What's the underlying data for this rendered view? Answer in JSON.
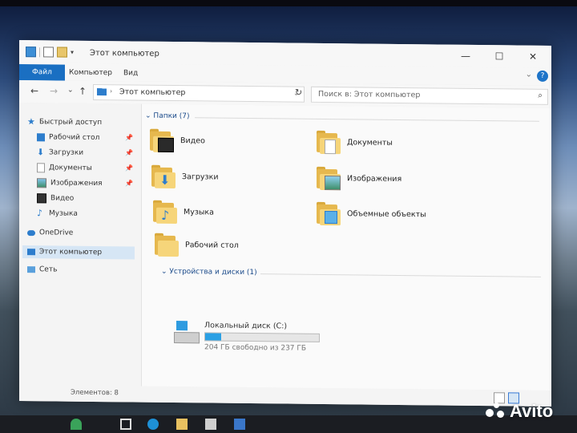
{
  "window": {
    "title": "Этот компьютер",
    "controls": {
      "minimize": "—",
      "maximize": "☐",
      "close": "✕"
    }
  },
  "ribbon": {
    "tabs": [
      "Файл",
      "Компьютер",
      "Вид"
    ],
    "help": "?"
  },
  "navigation": {
    "back": "←",
    "forward": "→",
    "recent": "⌄",
    "up": "↑",
    "address": "Этот компьютер",
    "refresh": "↻",
    "search_placeholder": "Поиск в: Этот компьютер"
  },
  "sidebar": {
    "items": [
      {
        "label": "Быстрый доступ",
        "icon": "star-icon",
        "pinned": false
      },
      {
        "label": "Рабочий стол",
        "icon": "desktop-icon",
        "pinned": true
      },
      {
        "label": "Загрузки",
        "icon": "download-icon",
        "pinned": true
      },
      {
        "label": "Документы",
        "icon": "document-icon",
        "pinned": true
      },
      {
        "label": "Изображения",
        "icon": "pictures-icon",
        "pinned": true
      },
      {
        "label": "Видео",
        "icon": "video-icon",
        "pinned": false
      },
      {
        "label": "Музыка",
        "icon": "music-icon",
        "pinned": false
      },
      {
        "label": "OneDrive",
        "icon": "cloud-icon",
        "pinned": false
      },
      {
        "label": "Этот компьютер",
        "icon": "computer-icon",
        "pinned": false,
        "selected": true
      },
      {
        "label": "Сеть",
        "icon": "network-icon",
        "pinned": false
      }
    ]
  },
  "content": {
    "folders_group": "Папки (7)",
    "folders": [
      "Видео",
      "Документы",
      "Загрузки",
      "Изображения",
      "Музыка",
      "Объемные объекты",
      "Рабочий стол"
    ],
    "drives_group": "Устройства и диски (1)",
    "drive": {
      "name": "Локальный диск (C:)",
      "free_text": "204 ГБ свободно из 237 ГБ",
      "used_fraction": 0.14
    }
  },
  "status": {
    "items_count": "Элементов: 8"
  },
  "watermark": "Avito",
  "colors": {
    "accent": "#1a6fc2",
    "folder": "#f6d57a",
    "drive_bar": "#2ba0e4"
  }
}
